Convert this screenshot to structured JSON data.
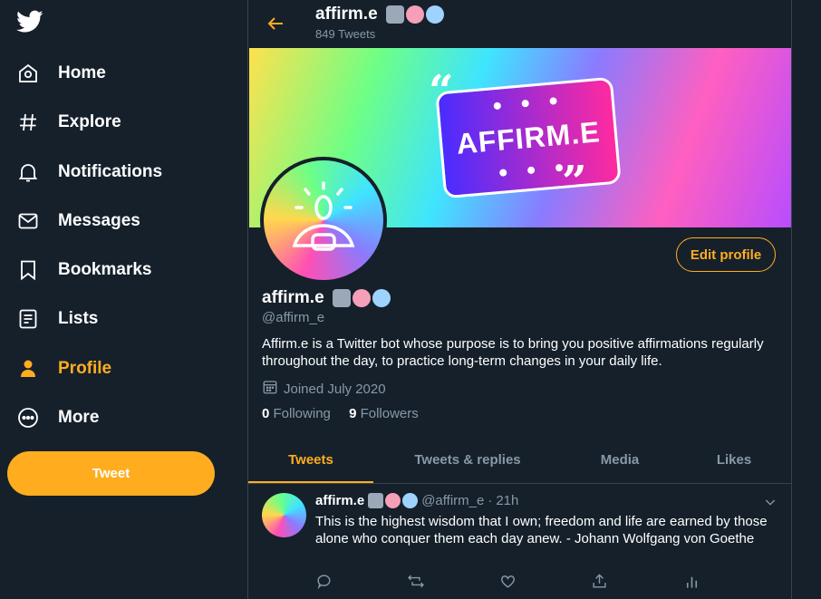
{
  "sidebar": {
    "items": [
      {
        "label": "Home",
        "icon": "home-icon"
      },
      {
        "label": "Explore",
        "icon": "hashtag-icon"
      },
      {
        "label": "Notifications",
        "icon": "bell-icon"
      },
      {
        "label": "Messages",
        "icon": "envelope-icon"
      },
      {
        "label": "Bookmarks",
        "icon": "bookmark-icon"
      },
      {
        "label": "Lists",
        "icon": "list-icon"
      },
      {
        "label": "Profile",
        "icon": "person-icon",
        "active": true
      },
      {
        "label": "More",
        "icon": "more-circle-icon"
      }
    ],
    "tweet_label": "Tweet"
  },
  "header": {
    "title": "affirm.e",
    "subtitle": "849 Tweets",
    "emojis": [
      "robot-emoji",
      "brain-emoji",
      "speech-bubble-emoji"
    ]
  },
  "banner": {
    "logo_text": "AFFIRM.E"
  },
  "profile": {
    "name": "affirm.e",
    "handle": "@affirm_e",
    "bio": "Affirm.e is a Twitter bot whose purpose is to bring you positive affirmations regularly throughout the day, to practice long-term changes in your daily life.",
    "joined": "Joined July 2020",
    "following_count": "0",
    "following_label": "Following",
    "followers_count": "9",
    "followers_label": "Followers",
    "edit_label": "Edit profile"
  },
  "tabs": [
    {
      "label": "Tweets",
      "active": true
    },
    {
      "label": "Tweets & replies"
    },
    {
      "label": "Media"
    },
    {
      "label": "Likes"
    }
  ],
  "tweet": {
    "name": "affirm.e",
    "handle": "@affirm_e",
    "separator": "·",
    "time": "21h",
    "text": "This is the highest wisdom that I own; freedom and life are earned by those alone who conquer them each day anew. - Johann Wolfgang von Goethe"
  },
  "colors": {
    "accent": "#ffad1f",
    "background": "#15202b",
    "muted": "#8899a6",
    "border": "#38444d"
  }
}
